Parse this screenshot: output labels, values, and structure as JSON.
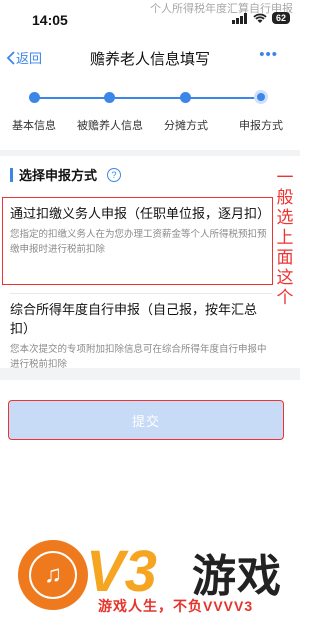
{
  "status": {
    "time": "14:05",
    "battery": "62",
    "overlay": "个人所得税年度汇算自行申报"
  },
  "nav": {
    "back_label": "返回",
    "title": "赡养老人信息填写",
    "more": "•••"
  },
  "steps": [
    {
      "label": "基本信息"
    },
    {
      "label": "被赡养人信息"
    },
    {
      "label": "分摊方式"
    },
    {
      "label": "申报方式"
    }
  ],
  "section": {
    "title": "选择申报方式",
    "help": "?"
  },
  "options": [
    {
      "title": "通过扣缴义务人申报（任职单位报，逐月扣）",
      "desc": "您指定的扣缴义务人在为您办理工资薪金等个人所得税预扣预缴申报时进行税前扣除"
    },
    {
      "title": "综合所得年度自行申报（自己报，按年汇总扣）",
      "desc": "您本次提交的专项附加扣除信息可在综合所得年度自行申报中进行税前扣除"
    }
  ],
  "submit_label": "提交",
  "annotation": [
    "一",
    "般",
    "选",
    "上",
    "面",
    "这",
    "个"
  ],
  "watermark": {
    "v3": "V3",
    "title": "游戏",
    "slogan": "游戏人生，不负VVVV3"
  },
  "colors": {
    "accent": "#3c86e8",
    "annotation": "#e33333",
    "logo_orange": "#ef7a1e"
  }
}
